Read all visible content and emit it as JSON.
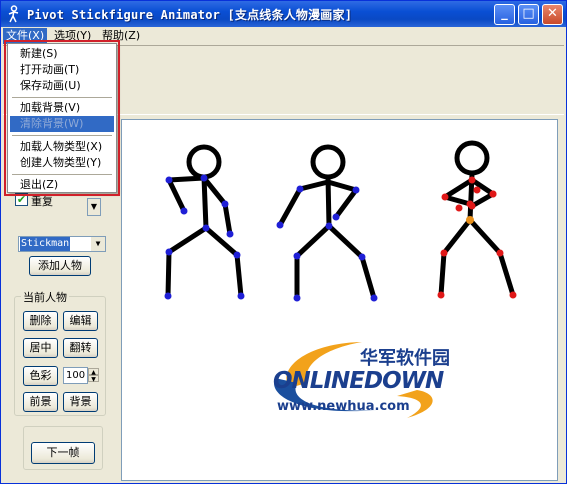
{
  "window": {
    "title": "Pivot Stickfigure Animator [支点线条人物漫画家]",
    "controls": {
      "minimize": "_",
      "maximize": "□",
      "close": "✕"
    }
  },
  "menubar": {
    "items": [
      {
        "label": "文件(X)"
      },
      {
        "label": "选项(Y)"
      },
      {
        "label": "帮助(Z)"
      }
    ]
  },
  "file_menu": {
    "items": [
      {
        "label": "新建(S)"
      },
      {
        "label": "打开动画(T)"
      },
      {
        "label": "保存动画(U)"
      },
      {
        "label": "加载背景(V)"
      },
      {
        "label": "清除背景(W)",
        "disabled": true
      },
      {
        "label": "加载人物类型(X)"
      },
      {
        "label": "创建人物类型(Y)"
      },
      {
        "label": "退出(Z)"
      }
    ]
  },
  "left_panel": {
    "repeat_label": "重复",
    "repeat_checked": true,
    "figure_type_selected": "Stickman",
    "add_figure_button": "添加人物",
    "current_figure_group": "当前人物",
    "delete_button": "删除",
    "edit_button": "编辑",
    "center_button": "居中",
    "flip_button": "翻转",
    "color_button": "色彩",
    "size_value": "100",
    "front_button": "前景",
    "back_button": "背景",
    "next_frame_button": "下一帧"
  },
  "logo": {
    "brand_cn": "华军软件园",
    "brand_en": "ONLINEDOWN",
    "url": "www.newhua.com"
  },
  "colors": {
    "joint_blue": "#1f1fd6",
    "joint_red": "#e01818",
    "joint_orange": "#e8901a",
    "highlight_red": "#d0202a"
  }
}
